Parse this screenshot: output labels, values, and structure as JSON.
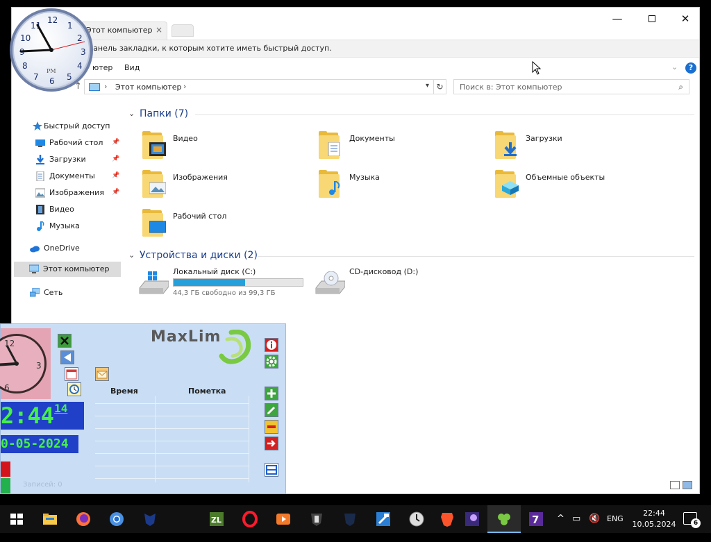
{
  "window": {
    "tab_title": "Этот компьютер",
    "tab_close": "×",
    "min": "—",
    "close": "✕",
    "bookmarks_hint": "Поместите сюда ссылки на веб-страницы, или перетащите их на панель закладки, к которым хотите иметь быстрый доступ.",
    "bookmarks_visible": "панель закладки, к которым хотите иметь быстрый доступ.",
    "ribbon": [
      "Компьютер",
      "Вид"
    ],
    "ribbon_visible": [
      "ютер",
      "Вид"
    ]
  },
  "address": {
    "path": "Этот компьютер",
    "search_placeholder": "Поиск в: Этот компьютер"
  },
  "sidebar": {
    "items": [
      {
        "label": "Быстрый доступ",
        "pinned": false
      },
      {
        "label": "Рабочий стол",
        "pinned": true
      },
      {
        "label": "Загрузки",
        "pinned": true
      },
      {
        "label": "Документы",
        "pinned": true
      },
      {
        "label": "Изображения",
        "pinned": true
      },
      {
        "label": "Видео",
        "pinned": false
      },
      {
        "label": "Музыка",
        "pinned": false
      },
      {
        "label": "OneDrive",
        "pinned": false
      },
      {
        "label": "Этот компьютер",
        "pinned": false,
        "active": true
      },
      {
        "label": "Сеть",
        "pinned": false
      }
    ]
  },
  "content": {
    "folders_header": "Папки (7)",
    "folders": [
      {
        "label": "Видео",
        "icon": "video-folder-icon"
      },
      {
        "label": "Документы",
        "icon": "documents-folder-icon"
      },
      {
        "label": "Загрузки",
        "icon": "downloads-folder-icon"
      },
      {
        "label": "Изображения",
        "icon": "pictures-folder-icon"
      },
      {
        "label": "Музыка",
        "icon": "music-folder-icon"
      },
      {
        "label": "Объемные объекты",
        "icon": "3d-objects-folder-icon"
      },
      {
        "label": "Рабочий стол",
        "icon": "desktop-folder-icon"
      }
    ],
    "devices_header": "Устройства и диски (2)",
    "drives": [
      {
        "label": "Локальный диск (C:)",
        "status": "44,3 ГБ свободно из 99,3 ГБ",
        "used_fraction": 0.554
      },
      {
        "label": "CD-дисковод (D:)"
      }
    ]
  },
  "clock": {
    "numbers": [
      "12",
      "1",
      "2",
      "3",
      "4",
      "5",
      "6",
      "7",
      "8",
      "9",
      "10",
      "11"
    ],
    "ampm": "PM"
  },
  "maxlim": {
    "logo": "MaxLim",
    "time": "2:44",
    "seconds": "14",
    "date": "0-05-2024",
    "col_time": "Время",
    "col_note": "Пометка",
    "clock_nums": [
      "12",
      "3",
      "6"
    ],
    "footer": "Записей: 0"
  },
  "taskbar": {
    "lang": "ENG",
    "time": "22:44",
    "date": "10.05.2024",
    "notifications": "6",
    "accent": "#76b9ed"
  }
}
